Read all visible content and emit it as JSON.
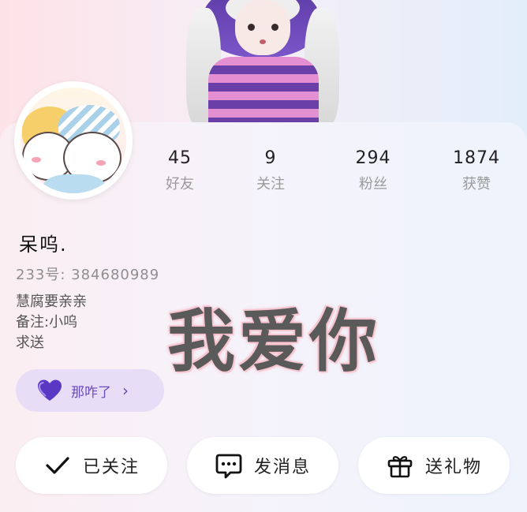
{
  "profile": {
    "name": "呆呜.",
    "uid_line": "233号: 384680989",
    "bio": [
      "慧腐要亲亲",
      "备注:小呜",
      "求送"
    ]
  },
  "stats": [
    {
      "value": "45",
      "label": "好友"
    },
    {
      "value": "9",
      "label": "关注"
    },
    {
      "value": "294",
      "label": "粉丝"
    },
    {
      "value": "1874",
      "label": "获赞"
    }
  ],
  "overlay_text": "我爱你",
  "medal": {
    "label": "那咋了",
    "icon": "purple-heart-icon",
    "color": "#6b4cc0"
  },
  "actions": [
    {
      "label": "已关注",
      "icon": "check-icon"
    },
    {
      "label": "发消息",
      "icon": "chat-bubble-icon"
    },
    {
      "label": "送礼物",
      "icon": "gift-icon"
    }
  ],
  "colors": {
    "accent": "#6b4cc0",
    "medal_bg": "#e7ddf6"
  }
}
